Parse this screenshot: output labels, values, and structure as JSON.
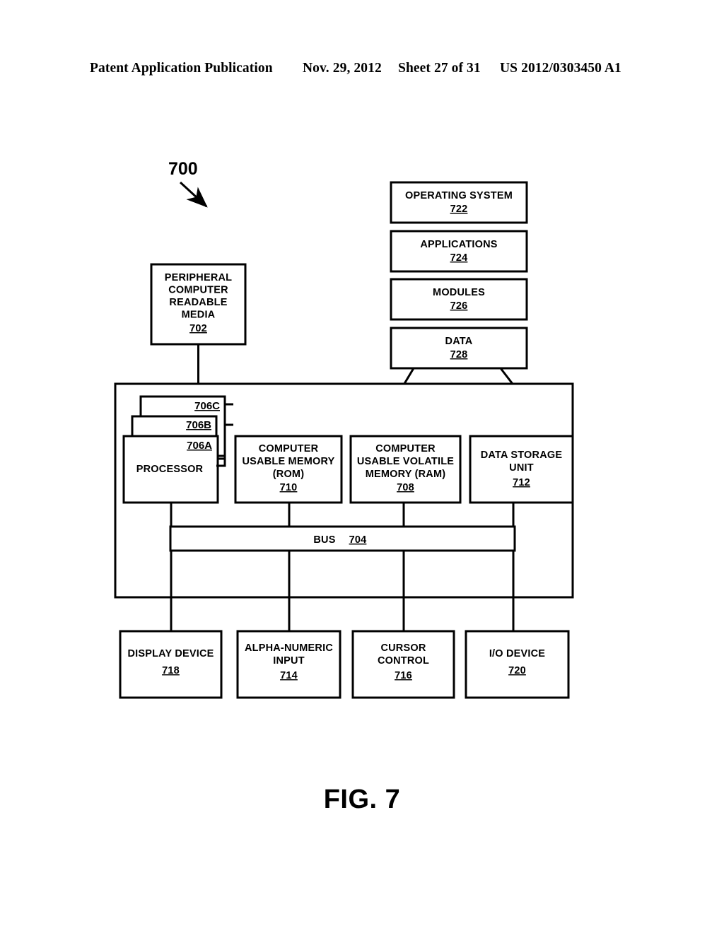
{
  "header": {
    "publication": "Patent Application Publication",
    "date": "Nov. 29, 2012",
    "sheet": "Sheet 27 of 31",
    "patent_number": "US 2012/0303450 A1"
  },
  "figure": {
    "caption": "FIG. 7",
    "system_reference": "700"
  },
  "diagram": {
    "peripheral": {
      "line1": "PERIPHERAL",
      "line2": "COMPUTER",
      "line3": "READABLE",
      "line4": "MEDIA",
      "ref": "702"
    },
    "software_stack": [
      {
        "label": "OPERATING SYSTEM",
        "ref": "722"
      },
      {
        "label": "APPLICATIONS",
        "ref": "724"
      },
      {
        "label": "MODULES",
        "ref": "726"
      },
      {
        "label": "DATA",
        "ref": "728"
      }
    ],
    "processor": {
      "label": "PROCESSOR",
      "ref_front": "706A",
      "ref_middle": "706B",
      "ref_back": "706C"
    },
    "rom": {
      "line1": "COMPUTER",
      "line2": "USABLE MEMORY",
      "line3": "(ROM)",
      "ref": "710"
    },
    "ram": {
      "line1": "COMPUTER",
      "line2": "USABLE VOLATILE",
      "line3": "MEMORY (RAM)",
      "ref": "708"
    },
    "data_storage": {
      "line1": "DATA STORAGE",
      "line2": "UNIT",
      "ref": "712"
    },
    "bus": {
      "label": "BUS",
      "ref": "704"
    },
    "peripherals": [
      {
        "line1": "DISPLAY DEVICE",
        "line2": "",
        "ref": "718"
      },
      {
        "line1": "ALPHA-NUMERIC",
        "line2": "INPUT",
        "ref": "714"
      },
      {
        "line1": "CURSOR",
        "line2": "CONTROL",
        "ref": "716"
      },
      {
        "line1": "I/O DEVICE",
        "line2": "",
        "ref": "720"
      }
    ]
  },
  "colors": {
    "ink": "#000000",
    "paper": "#ffffff"
  }
}
